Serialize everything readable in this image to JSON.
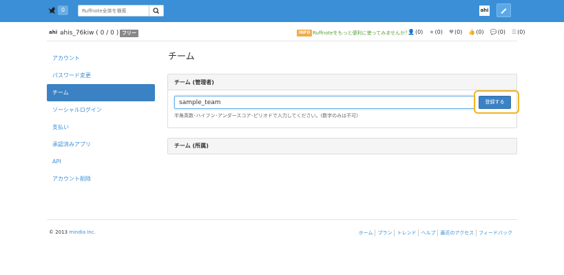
{
  "navbar": {
    "notification_count": "0",
    "search_placeholder": "Ruffnote全体を検索",
    "user_avatar_text": "ahi",
    "brand_color": "#3a8fd6"
  },
  "userbar": {
    "avatar_text": "ahi",
    "username": "ahis_76kiw ( 0 / 0 ) ▾",
    "plan_badge": "フリー",
    "info_badge": "INFO",
    "promo_text": "Ruffnoteをもっと便利に使ってみませんか？",
    "counts": [
      {
        "icon": "user-icon",
        "glyph": "👤",
        "value": "(0)"
      },
      {
        "icon": "star-icon",
        "glyph": "★",
        "value": "(0)"
      },
      {
        "icon": "heart-icon",
        "glyph": "♥",
        "value": "(0)"
      },
      {
        "icon": "thumbs-up-icon",
        "glyph": "👍",
        "value": "(0)"
      },
      {
        "icon": "comments-icon",
        "glyph": "💬",
        "value": "(0)"
      },
      {
        "icon": "list-icon",
        "glyph": "☰",
        "value": "(0)"
      }
    ]
  },
  "sidebar": {
    "items": [
      {
        "label": "アカウント",
        "active": false
      },
      {
        "label": "パスワード変更",
        "active": false
      },
      {
        "label": "チーム",
        "active": true
      },
      {
        "label": "ソーシャルログイン",
        "active": false
      },
      {
        "label": "支払い",
        "active": false
      },
      {
        "label": "承認済みアプリ",
        "active": false
      },
      {
        "label": "API",
        "active": false
      },
      {
        "label": "アカウント削除",
        "active": false
      }
    ]
  },
  "main": {
    "title": "チーム",
    "admin_panel": {
      "heading": "チーム (管理者)",
      "input_value": "sample_team",
      "hint": "半角英数･ハイフン･アンダースコア･ピリオドで入力してください。(数字のみは不可)",
      "register_label": "登録する"
    },
    "member_panel": {
      "heading": "チーム (所属)"
    }
  },
  "footer": {
    "copyright_prefix": "© 2013 ",
    "company": "mindia Inc.",
    "links": [
      "ホーム",
      "プラン",
      "トレンド",
      "ヘルプ",
      "最近のアクセス",
      "フィードバック"
    ]
  }
}
